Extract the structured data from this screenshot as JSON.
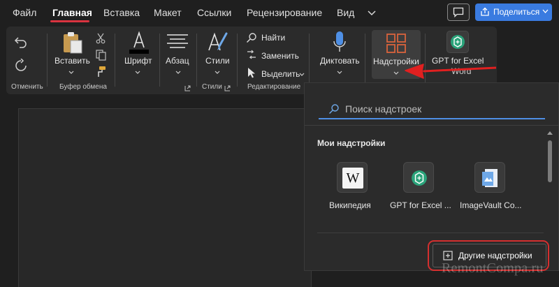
{
  "tabs": [
    "Файл",
    "Главная",
    "Вставка",
    "Макет",
    "Ссылки",
    "Рецензирование",
    "Вид"
  ],
  "share": {
    "label": "Поделиться"
  },
  "ribbon": {
    "undo_group_label": "Отменить",
    "paste_label": "Вставить",
    "clipboard_label": "Буфер обмена",
    "font_label": "Шрифт",
    "paragraph_label": "Абзац",
    "styles_label": "Стили",
    "styles_group_label": "Стили",
    "find_label": "Найти",
    "replace_label": "Заменить",
    "select_label": "Выделить",
    "editing_group_label": "Редактирование",
    "dictate_label": "Диктовать",
    "addins_label": "Надстройки",
    "gpt_label": "GPT for Excel",
    "gpt_label_cut": "Word"
  },
  "panel": {
    "search_placeholder": "Поиск надстроек",
    "section_title": "Мои надстройки",
    "addins": [
      {
        "label": "Википедия",
        "icon": "wikipedia-icon"
      },
      {
        "label": "GPT for Excel ...",
        "icon": "gpt-icon"
      },
      {
        "label": "ImageVault Co...",
        "icon": "imagevault-icon"
      }
    ],
    "more_label": "Другие надстройки"
  },
  "watermark": "RemontCompa.ru",
  "colors": {
    "accent": "#3a7be0",
    "highlight": "#d42f2f",
    "addins_icon": "#d9633c",
    "gpt": "#2aa37a"
  }
}
